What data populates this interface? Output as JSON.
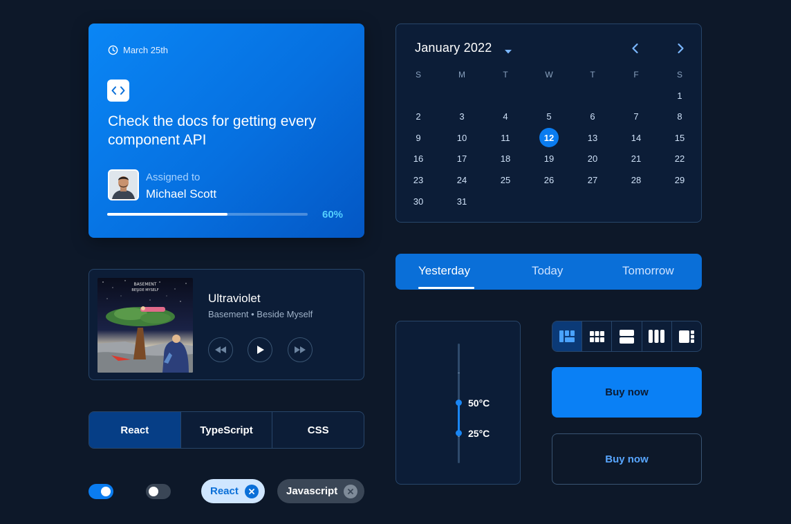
{
  "task": {
    "date": "March 25th",
    "title": "Check the docs for getting every component API",
    "assigned_label": "Assigned to",
    "assignee": "Michael Scott",
    "progress_percent": 60,
    "progress_label": "60%"
  },
  "calendar": {
    "title": "January 2022",
    "weekdays": [
      "S",
      "M",
      "T",
      "W",
      "T",
      "F",
      "S"
    ],
    "selected_day": 12,
    "days": [
      1,
      2,
      3,
      4,
      5,
      6,
      7,
      8,
      9,
      10,
      11,
      12,
      13,
      14,
      15,
      16,
      17,
      18,
      19,
      20,
      21,
      22,
      23,
      24,
      25,
      26,
      27,
      28,
      29,
      30,
      31
    ]
  },
  "player": {
    "song": "Ultraviolet",
    "meta": "Basement • Beside Myself",
    "album_text_1": "BASEMENT",
    "album_text_2": "BESIDE MYSELF"
  },
  "lang_tabs": [
    "React",
    "TypeScript",
    "CSS"
  ],
  "lang_tabs_active": 0,
  "toggles": {
    "first_on": true,
    "second_on": false
  },
  "chips": [
    {
      "label": "React"
    },
    {
      "label": "Javascript"
    }
  ],
  "day_tabs": [
    "Yesterday",
    "Today",
    "Tomorrow"
  ],
  "day_tabs_active": 0,
  "temperature": {
    "upper_label": "50°C",
    "lower_label": "25°C"
  },
  "layout_buttons": [
    "dashboard-layout-icon",
    "grid-layout-icon",
    "rows-layout-icon",
    "columns-layout-icon",
    "sidebar-layout-icon"
  ],
  "buy": {
    "primary_label": "Buy now",
    "outline_label": "Buy now"
  },
  "colors": {
    "background": "#0d1829",
    "accent": "#0a80f5",
    "progress_label": "#54d0ff"
  }
}
